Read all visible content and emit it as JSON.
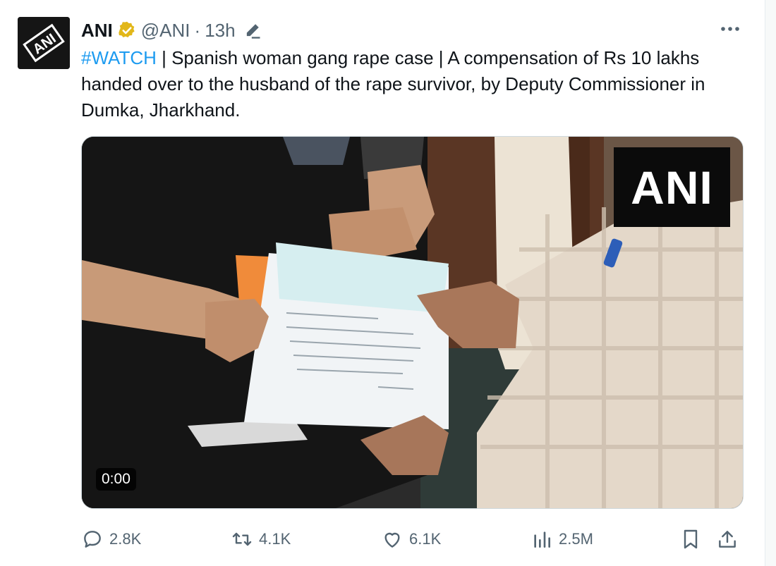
{
  "tweet": {
    "author_name": "ANI",
    "handle": "@ANI",
    "separator": "·",
    "time": "13h",
    "hashtag": "#WATCH",
    "body": " | Spanish woman gang rape case | A compensation of Rs 10 lakhs handed over to the husband of the rape survivor, by Deputy Commissioner in Dumka, Jharkhand.",
    "avatar_text": "ANI",
    "icons": {
      "verified": "verified-badge-icon",
      "edit": "edited-pencil-icon",
      "more": "more-options-icon"
    }
  },
  "media": {
    "watermark": "ANI",
    "timestamp": "0:00"
  },
  "actions": {
    "replies": "2.8K",
    "retweets": "4.1K",
    "likes": "6.1K",
    "views": "2.5M"
  },
  "colors": {
    "accent": "#1d9bf0",
    "verified_gold": "#e2b719",
    "muted_text": "#536471"
  }
}
